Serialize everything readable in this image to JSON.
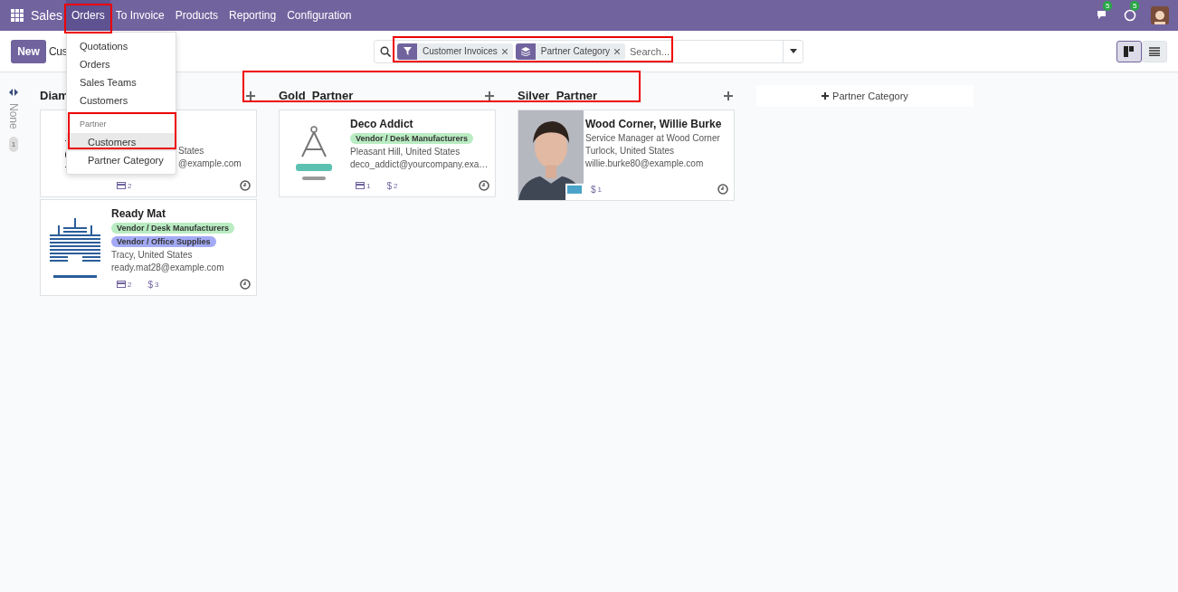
{
  "navbar": {
    "app": "Sales",
    "menus": [
      {
        "label": "Orders",
        "selected": true
      },
      {
        "label": "To Invoice",
        "selected": false
      },
      {
        "label": "Products",
        "selected": false
      },
      {
        "label": "Reporting",
        "selected": false
      },
      {
        "label": "Configuration",
        "selected": false
      }
    ],
    "messages_count": "5",
    "activities_count": "5"
  },
  "control_panel": {
    "new_button": "New",
    "breadcrumb": "Cus",
    "search": {
      "facets": [
        {
          "kind": "filter",
          "label": "Customer Invoices"
        },
        {
          "kind": "group",
          "label": "Partner Category"
        }
      ],
      "placeholder": "Search..."
    },
    "views": [
      {
        "kind": "kanban",
        "selected": true
      },
      {
        "kind": "list",
        "selected": false
      }
    ]
  },
  "dropdown": {
    "items": [
      {
        "kind": "item",
        "label": "Quotations",
        "selected": false
      },
      {
        "kind": "item",
        "label": "Orders",
        "selected": false
      },
      {
        "kind": "item",
        "label": "Sales Teams",
        "selected": false
      },
      {
        "kind": "item",
        "label": "Customers",
        "selected": false
      },
      {
        "kind": "header",
        "label": "Partner"
      },
      {
        "kind": "subitem",
        "label": "Customers",
        "selected": true
      },
      {
        "kind": "subitem",
        "label": "Partner Category",
        "selected": false
      }
    ]
  },
  "folded_column": {
    "title": "None",
    "count": "1"
  },
  "columns": [
    {
      "title": "Diam",
      "cards": [
        {
          "covered": true,
          "lines": [
            "States"
          ],
          "email": "@example.com",
          "stats": [
            {
              "kind": "card",
              "value": "2"
            }
          ]
        },
        {
          "covered": false,
          "name": "Ready Mat",
          "tags": [
            {
              "label": "Vendor / Desk Manufacturers",
              "color": "#b9ecc2"
            },
            {
              "label": "Vendor / Office Supplies",
              "color": "#a3aaf5"
            }
          ],
          "lines": [
            "Tracy, United States"
          ],
          "email": "ready.mat28@example.com",
          "stats": [
            {
              "kind": "card",
              "value": "2"
            },
            {
              "kind": "money",
              "symbol": "$",
              "value": "3"
            }
          ]
        }
      ]
    },
    {
      "title": "Gold_Partner",
      "cards": [
        {
          "covered": false,
          "name": "Deco Addict",
          "tags": [
            {
              "label": "Vendor / Desk Manufacturers",
              "color": "#b9ecc2"
            }
          ],
          "lines": [
            "Pleasant Hill, United States"
          ],
          "email": "deco_addict@yourcompany.exa…",
          "stats": [
            {
              "kind": "card",
              "value": "1"
            },
            {
              "kind": "money",
              "symbol": "$",
              "value": "2"
            }
          ]
        }
      ]
    },
    {
      "title": "Silver_Partner",
      "cards": [
        {
          "covered": false,
          "name": "Wood Corner, Willie Burke",
          "lines": [
            "Service Manager at Wood Corner",
            "Turlock, United States"
          ],
          "email": "willie.burke80@example.com",
          "stats": [
            {
              "kind": "money",
              "symbol": "$",
              "value": "1"
            }
          ]
        }
      ]
    }
  ],
  "add_column": "Partner Category"
}
